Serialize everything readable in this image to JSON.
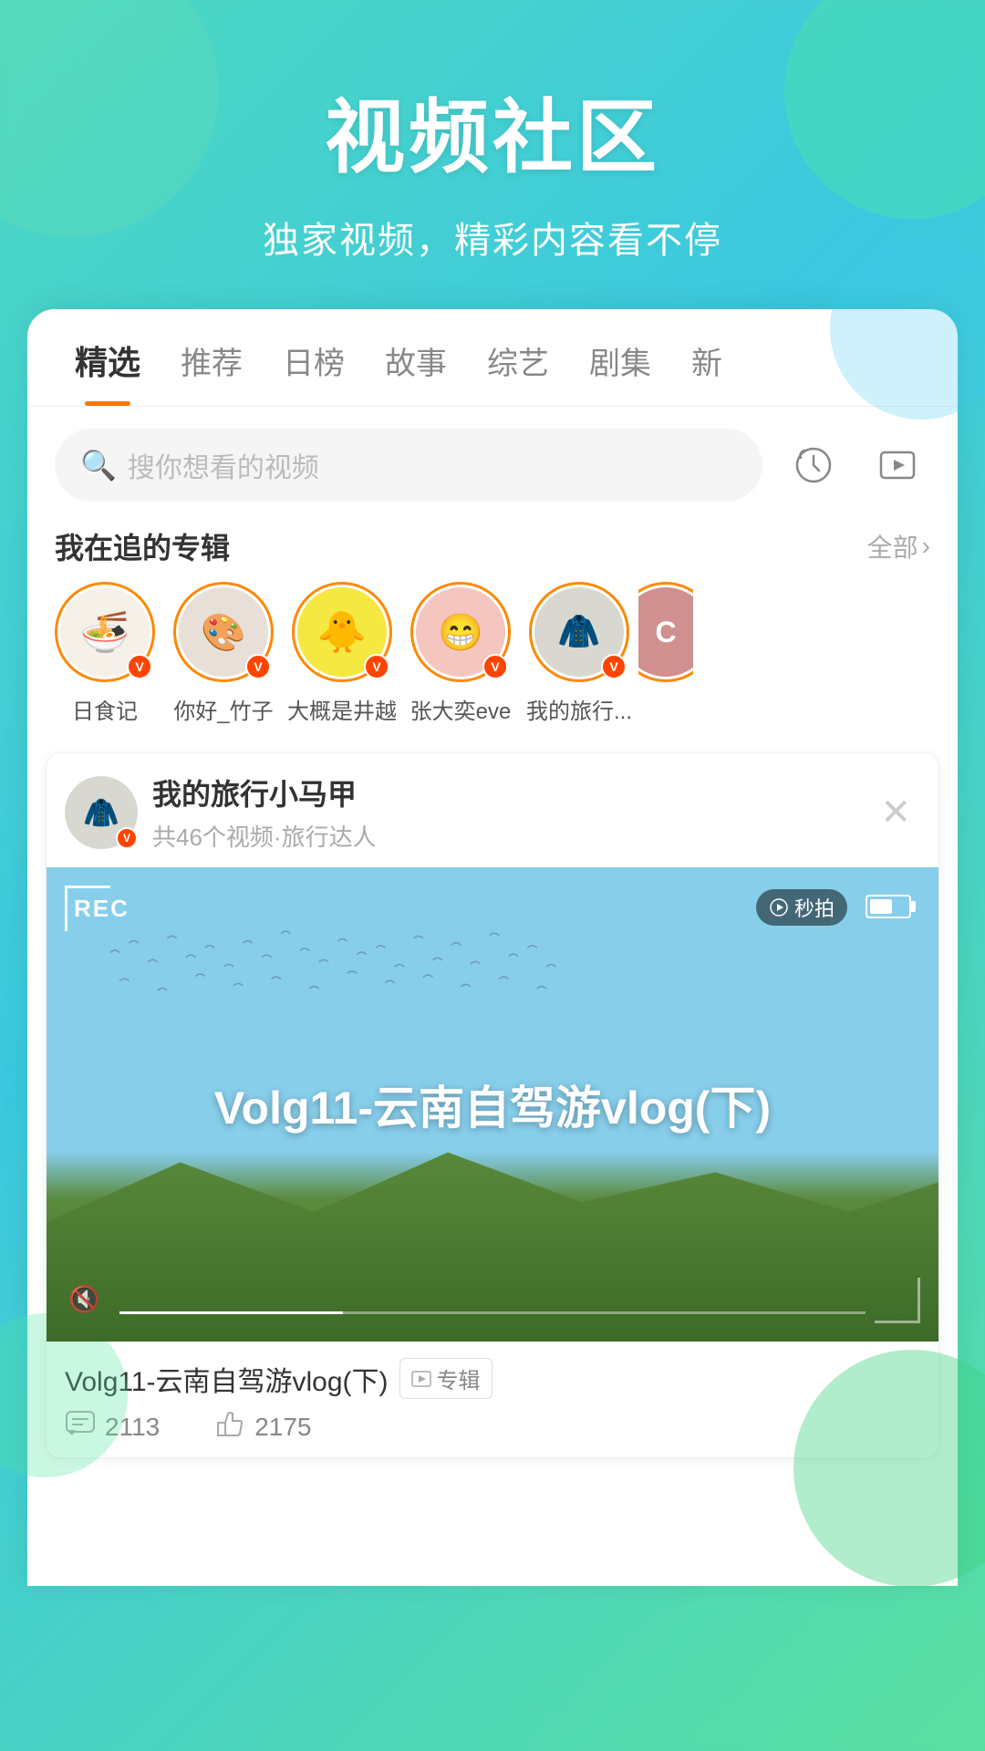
{
  "header": {
    "title": "视频社区",
    "subtitle": "独家视频，精彩内容看不停"
  },
  "tabs": [
    {
      "id": "featured",
      "label": "精选",
      "active": true
    },
    {
      "id": "recommend",
      "label": "推荐",
      "active": false
    },
    {
      "id": "daily",
      "label": "日榜",
      "active": false
    },
    {
      "id": "story",
      "label": "故事",
      "active": false
    },
    {
      "id": "variety",
      "label": "综艺",
      "active": false
    },
    {
      "id": "series",
      "label": "剧集",
      "active": false
    },
    {
      "id": "new",
      "label": "新",
      "active": false
    }
  ],
  "search": {
    "placeholder": "搜你想看的视频"
  },
  "following_section": {
    "title": "我在追的专辑",
    "more_label": "全部"
  },
  "avatars": [
    {
      "id": "av1",
      "label": "日食记",
      "emoji": "🍜",
      "color": "#f5f0e8"
    },
    {
      "id": "av2",
      "label": "你好_竹子",
      "emoji": "🎨",
      "color": "#e8e0d8"
    },
    {
      "id": "av3",
      "label": "大概是井越",
      "emoji": "🐥",
      "color": "#f0e040"
    },
    {
      "id": "av4",
      "label": "张大奕eve",
      "emoji": "😊",
      "color": "#f5c5c0"
    },
    {
      "id": "av5",
      "label": "我的旅行...",
      "emoji": "🧥",
      "color": "#d8d8d0"
    },
    {
      "id": "av6",
      "label": "C",
      "emoji": "C",
      "color": "#e0a0a0"
    }
  ],
  "preview_card": {
    "name": "我的旅行小马甲",
    "meta": "共46个视频·旅行达人",
    "avatar_emoji": "🧥",
    "avatar_color": "#d8d8d0"
  },
  "video": {
    "rec_label": "REC",
    "title": "Volg11-云南自驾游vlog(下)",
    "title_overlay": "Volg11-云南自驾游vlog(下)",
    "tag": "专辑",
    "comment_count": "2113",
    "like_count": "2175"
  }
}
